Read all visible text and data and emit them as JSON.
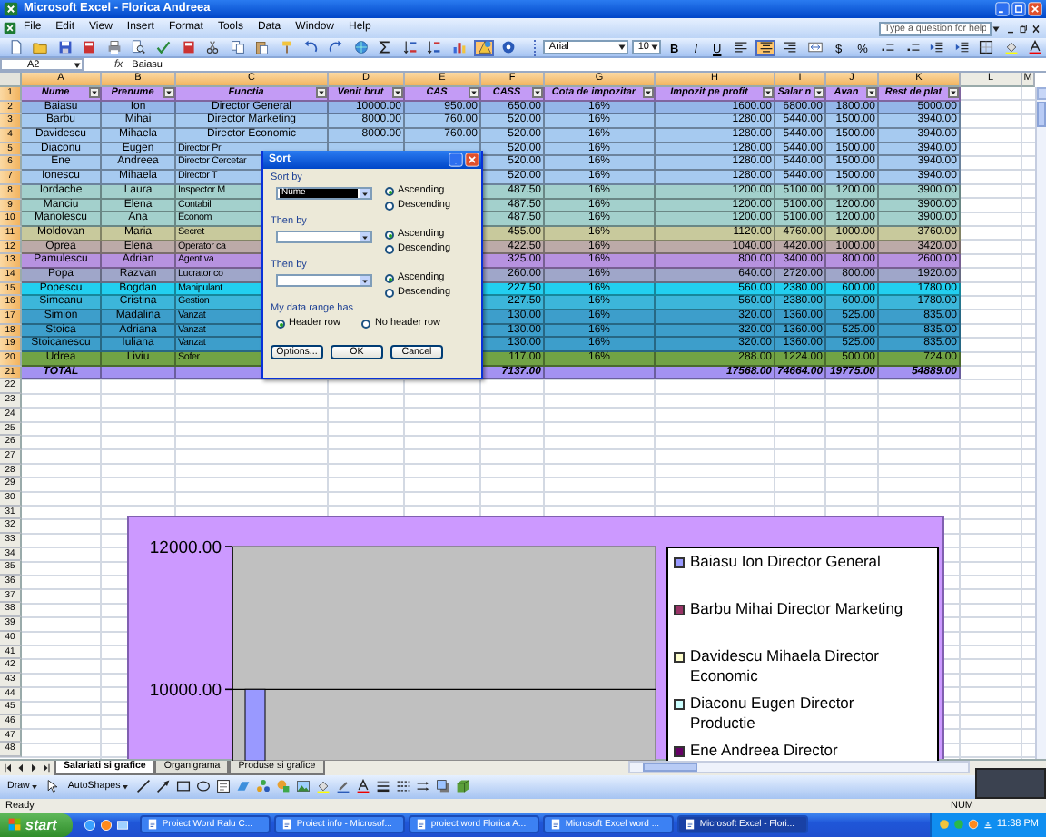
{
  "window": {
    "title": "Microsoft Excel - Florica Andreea"
  },
  "menu": [
    "File",
    "Edit",
    "View",
    "Insert",
    "Format",
    "Tools",
    "Data",
    "Window",
    "Help"
  ],
  "help_box": {
    "placeholder": "Type a question for help"
  },
  "standard_toolbar": {
    "drawing_toggle": {
      "selected": true
    }
  },
  "formatting": {
    "font": "Arial",
    "size": "10",
    "bold": "B",
    "italic": "I",
    "underline": "U",
    "alignment": [
      {
        "selected": false
      },
      {
        "selected": true
      },
      {
        "selected": false
      },
      {
        "selected": false
      }
    ],
    "currency": "$",
    "percent": "%"
  },
  "formula_bar": {
    "name_box": "A2",
    "fx": "fx",
    "value": "Baiasu"
  },
  "column_headers": [
    {
      "label": "A",
      "selected": true
    },
    {
      "label": "B",
      "selected": true
    },
    {
      "label": "C",
      "selected": true
    },
    {
      "label": "D",
      "selected": true
    },
    {
      "label": "E",
      "selected": true
    },
    {
      "label": "F",
      "selected": true
    },
    {
      "label": "G",
      "selected": true
    },
    {
      "label": "H",
      "selected": true
    },
    {
      "label": "I",
      "selected": true
    },
    {
      "label": "J",
      "selected": true
    },
    {
      "label": "K",
      "selected": true
    },
    {
      "label": "L",
      "selected": false
    },
    {
      "label": "M",
      "selected": false
    }
  ],
  "row_headers": [
    {
      "label": "1",
      "selected": true
    },
    {
      "label": "2",
      "selected": true
    },
    {
      "label": "3",
      "selected": true
    },
    {
      "label": "4",
      "selected": true
    },
    {
      "label": "5",
      "selected": true
    },
    {
      "label": "6",
      "selected": true
    },
    {
      "label": "7",
      "selected": true
    },
    {
      "label": "8",
      "selected": true
    },
    {
      "label": "9",
      "selected": true
    },
    {
      "label": "10",
      "selected": true
    },
    {
      "label": "11",
      "selected": true
    },
    {
      "label": "12",
      "selected": true
    },
    {
      "label": "13",
      "selected": true
    },
    {
      "label": "14",
      "selected": true
    },
    {
      "label": "15",
      "selected": true
    },
    {
      "label": "16",
      "selected": true
    },
    {
      "label": "17",
      "selected": true
    },
    {
      "label": "18",
      "selected": true
    },
    {
      "label": "19",
      "selected": true
    },
    {
      "label": "20",
      "selected": true
    },
    {
      "label": "21",
      "selected": true
    },
    {
      "label": "22",
      "selected": false
    },
    {
      "label": "23",
      "selected": false
    },
    {
      "label": "24",
      "selected": false
    },
    {
      "label": "25",
      "selected": false
    },
    {
      "label": "26",
      "selected": false
    },
    {
      "label": "27",
      "selected": false
    },
    {
      "label": "28",
      "selected": false
    },
    {
      "label": "29",
      "selected": false
    },
    {
      "label": "30",
      "selected": false
    },
    {
      "label": "31",
      "selected": false
    },
    {
      "label": "32",
      "selected": false
    },
    {
      "label": "33",
      "selected": false
    },
    {
      "label": "34",
      "selected": false
    },
    {
      "label": "35",
      "selected": false
    },
    {
      "label": "36",
      "selected": false
    },
    {
      "label": "37",
      "selected": false
    },
    {
      "label": "38",
      "selected": false
    },
    {
      "label": "39",
      "selected": false
    },
    {
      "label": "40",
      "selected": false
    },
    {
      "label": "41",
      "selected": false
    },
    {
      "label": "42",
      "selected": false
    },
    {
      "label": "43",
      "selected": false
    },
    {
      "label": "44",
      "selected": false
    },
    {
      "label": "45",
      "selected": false
    },
    {
      "label": "46",
      "selected": false
    },
    {
      "label": "47",
      "selected": false
    },
    {
      "label": "48",
      "selected": false
    }
  ],
  "table": {
    "columns": [
      "Nume",
      "Prenume",
      "Functia",
      "Venit brut",
      "CAS",
      "CASS",
      "Cota de impozitar",
      "Impozit pe profit",
      "Salar n",
      "Avan",
      "Rest de plat"
    ],
    "rows": [
      {
        "kind": "data",
        "color": "#94b6e8",
        "A": "Baiasu",
        "B": "Ion",
        "C": "Director General",
        "D": "10000.00",
        "E": "950.00",
        "F": "650.00",
        "G": "16%",
        "H": "1600.00",
        "I": "6800.00",
        "J": "1800.00",
        "K": "5000.00"
      },
      {
        "kind": "data",
        "color": "#a6caf0",
        "A": "Barbu",
        "B": "Mihai",
        "C": "Director Marketing",
        "D": "8000.00",
        "E": "760.00",
        "F": "520.00",
        "G": "16%",
        "H": "1280.00",
        "I": "5440.00",
        "J": "1500.00",
        "K": "3940.00"
      },
      {
        "kind": "data",
        "color": "#a6caf0",
        "A": "Davidescu",
        "B": "Mihaela",
        "C": "Director Economic",
        "D": "8000.00",
        "E": "760.00",
        "F": "520.00",
        "G": "16%",
        "H": "1280.00",
        "I": "5440.00",
        "J": "1500.00",
        "K": "3940.00"
      },
      {
        "kind": "data",
        "color": "#a6caf0",
        "A": "Diaconu",
        "B": "Eugen",
        "C": "Director Pr",
        "F": "520.00",
        "G": "16%",
        "H": "1280.00",
        "I": "5440.00",
        "J": "1500.00",
        "K": "3940.00"
      },
      {
        "kind": "data",
        "color": "#a6caf0",
        "A": "Ene",
        "B": "Andreea",
        "C": "Director Cercetar",
        "F": "520.00",
        "G": "16%",
        "H": "1280.00",
        "I": "5440.00",
        "J": "1500.00",
        "K": "3940.00"
      },
      {
        "kind": "data",
        "color": "#a6caf0",
        "A": "Ionescu",
        "B": "Mihaela",
        "C": "Director T",
        "F": "520.00",
        "G": "16%",
        "H": "1280.00",
        "I": "5440.00",
        "J": "1500.00",
        "K": "3940.00"
      },
      {
        "kind": "data",
        "color": "#a3d0cc",
        "A": "Iordache",
        "B": "Laura",
        "C": "Inspector M",
        "F": "487.50",
        "G": "16%",
        "H": "1200.00",
        "I": "5100.00",
        "J": "1200.00",
        "K": "3900.00"
      },
      {
        "kind": "data",
        "color": "#a3d0cc",
        "A": "Manciu",
        "B": "Elena",
        "C": "Contabil",
        "F": "487.50",
        "G": "16%",
        "H": "1200.00",
        "I": "5100.00",
        "J": "1200.00",
        "K": "3900.00"
      },
      {
        "kind": "data",
        "color": "#a3d0cc",
        "A": "Manolescu",
        "B": "Ana",
        "C": "Econom",
        "F": "487.50",
        "G": "16%",
        "H": "1200.00",
        "I": "5100.00",
        "J": "1200.00",
        "K": "3900.00"
      },
      {
        "kind": "data",
        "color": "#c8c99c",
        "A": "Moldovan",
        "B": "Maria",
        "C": "Secret",
        "F": "455.00",
        "G": "16%",
        "H": "1120.00",
        "I": "4760.00",
        "J": "1000.00",
        "K": "3760.00"
      },
      {
        "kind": "data",
        "color": "#bcaaa8",
        "A": "Oprea",
        "B": "Elena",
        "C": "Operator ca",
        "F": "422.50",
        "G": "16%",
        "H": "1040.00",
        "I": "4420.00",
        "J": "1000.00",
        "K": "3420.00"
      },
      {
        "kind": "data",
        "color": "#b792e0",
        "A": "Pamulescu",
        "B": "Adrian",
        "C": "Agent va",
        "F": "325.00",
        "G": "16%",
        "H": "800.00",
        "I": "3400.00",
        "J": "800.00",
        "K": "2600.00"
      },
      {
        "kind": "data",
        "color": "#9fa6c9",
        "A": "Popa",
        "B": "Razvan",
        "C": "Lucrator co",
        "F": "260.00",
        "G": "16%",
        "H": "640.00",
        "I": "2720.00",
        "J": "800.00",
        "K": "1920.00"
      },
      {
        "kind": "data",
        "color": "#22cff0",
        "A": "Popescu",
        "B": "Bogdan",
        "C": "Manipulant",
        "F": "227.50",
        "G": "16%",
        "H": "560.00",
        "I": "2380.00",
        "J": "600.00",
        "K": "1780.00"
      },
      {
        "kind": "data",
        "color": "#3cb6da",
        "A": "Simeanu",
        "B": "Cristina",
        "C": "Gestion",
        "F": "227.50",
        "G": "16%",
        "H": "560.00",
        "I": "2380.00",
        "J": "600.00",
        "K": "1780.00"
      },
      {
        "kind": "data",
        "color": "#3d9ecb",
        "A": "Simion",
        "B": "Madalina",
        "C": "Vanzat",
        "F": "130.00",
        "G": "16%",
        "H": "320.00",
        "I": "1360.00",
        "J": "525.00",
        "K": "835.00"
      },
      {
        "kind": "data",
        "color": "#3d9ecb",
        "A": "Stoica",
        "B": "Adriana",
        "C": "Vanzat",
        "F": "130.00",
        "G": "16%",
        "H": "320.00",
        "I": "1360.00",
        "J": "525.00",
        "K": "835.00"
      },
      {
        "kind": "data",
        "color": "#3d9ecb",
        "A": "Stoicanescu",
        "B": "Iuliana",
        "C": "Vanzat",
        "F": "130.00",
        "G": "16%",
        "H": "320.00",
        "I": "1360.00",
        "J": "525.00",
        "K": "835.00"
      },
      {
        "kind": "data",
        "color": "#71a345",
        "A": "Udrea",
        "B": "Liviu",
        "C": "Sofer",
        "F": "117.00",
        "G": "16%",
        "H": "288.00",
        "I": "1224.00",
        "J": "500.00",
        "K": "724.00"
      },
      {
        "kind": "total",
        "color": "#a392f2",
        "A": "TOTAL",
        "F": "7137.00",
        "H": "17568.00",
        "I": "74664.00",
        "J": "19775.00",
        "K": "54889.00"
      }
    ]
  },
  "chart": {
    "chart_data": {
      "type": "bar",
      "ylim": [
        9000,
        12000
      ],
      "yticks": [
        {
          "value": 10000,
          "label": "10000.00"
        },
        {
          "value": 12000,
          "label": "12000.00"
        }
      ],
      "series": [
        {
          "name": "Baiasu Ion Director General",
          "color": "#9999ff",
          "values": [
            10000
          ]
        },
        {
          "name": "Barbu Mihai Director Marketing",
          "color": "#993366",
          "values": [
            null
          ]
        },
        {
          "name": "Davidescu Mihaela Director Economic",
          "color": "#ffffcc",
          "values": [
            null
          ]
        },
        {
          "name": "Diaconu Eugen Director Productie",
          "color": "#ccffff",
          "values": [
            null
          ]
        },
        {
          "name": "Ene Andreea Director",
          "color": "#660066",
          "values": [
            null
          ]
        }
      ]
    }
  },
  "dialog": {
    "title": "Sort",
    "sections": [
      {
        "label": "Sort by",
        "value": "Nume",
        "options": [
          {
            "label": "Ascending",
            "selected": true
          },
          {
            "label": "Descending",
            "selected": false
          }
        ]
      },
      {
        "label": "Then by",
        "options": [
          {
            "label": "Ascending",
            "selected": true
          },
          {
            "label": "Descending",
            "selected": false
          }
        ]
      },
      {
        "label": "Then by",
        "options": [
          {
            "label": "Ascending",
            "selected": true
          },
          {
            "label": "Descending",
            "selected": false
          }
        ]
      }
    ],
    "range_label": "My data range has",
    "range_options": [
      {
        "label": "Header row",
        "selected": true
      },
      {
        "label": "No header row",
        "selected": false
      }
    ],
    "buttons": [
      "Options...",
      "OK",
      "Cancel"
    ]
  },
  "sheet_tabs": [
    {
      "label": "Salariati si grafice",
      "selected": true
    },
    {
      "label": "Organigrama",
      "selected": false
    },
    {
      "label": "Produse si grafice",
      "selected": false
    }
  ],
  "drawing_toolbar": {
    "draw": "Draw",
    "autoshapes": "AutoShapes"
  },
  "status_bar": {
    "left": "Ready",
    "right": "NUM"
  },
  "taskbar": {
    "start": "start",
    "buttons": [
      {
        "label": "Proiect Word Ralu C...",
        "selected": false
      },
      {
        "label": "Proiect info - Microsof...",
        "selected": false
      },
      {
        "label": "proiect word Florica A...",
        "selected": false
      },
      {
        "label": "Microsoft Excel word ...",
        "selected": false
      },
      {
        "label": "Microsoft Excel - Flori...",
        "selected": true
      }
    ],
    "clock": "11:38 PM"
  }
}
